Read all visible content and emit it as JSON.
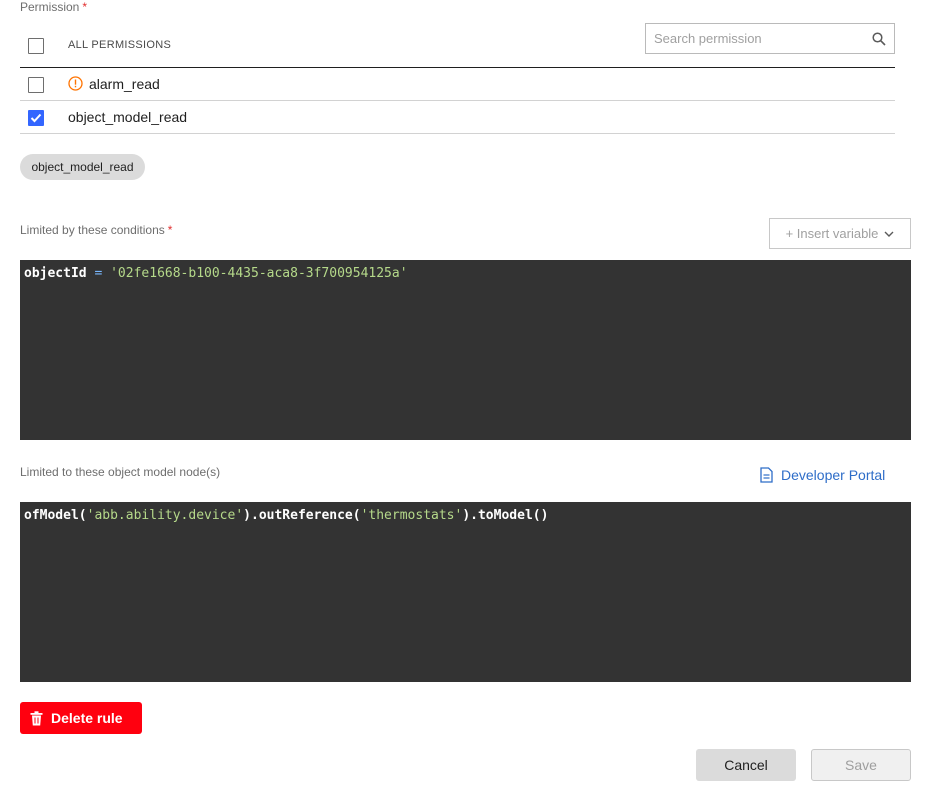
{
  "permission": {
    "label": "Permission",
    "required_mark": "*",
    "all_label": "ALL PERMISSIONS",
    "search_placeholder": "Search permission",
    "items": [
      {
        "name": "alarm_read",
        "checked": false,
        "warning": true
      },
      {
        "name": "object_model_read",
        "checked": true,
        "warning": false
      }
    ],
    "selected_chip": "object_model_read"
  },
  "conditions": {
    "label": "Limited by these conditions",
    "required_mark": "*",
    "insert_variable": "+ Insert variable",
    "code": {
      "ident": "objectId",
      "op": "=",
      "value": "'02fe1668-b100-4435-aca8-3f700954125a'"
    }
  },
  "nodes": {
    "label": "Limited to these object model node(s)",
    "developer_portal": "Developer Portal",
    "code": {
      "p1": "ofModel(",
      "s1": "'abb.ability.device'",
      "p2": ").outReference(",
      "s2": "'thermostats'",
      "p3": ").toModel()"
    }
  },
  "actions": {
    "delete": "Delete rule",
    "cancel": "Cancel",
    "save": "Save"
  },
  "colors": {
    "accent_blue": "#3366ff",
    "danger_red": "#ff000f",
    "warning_orange": "#ff7300",
    "editor_bg": "#333333"
  }
}
